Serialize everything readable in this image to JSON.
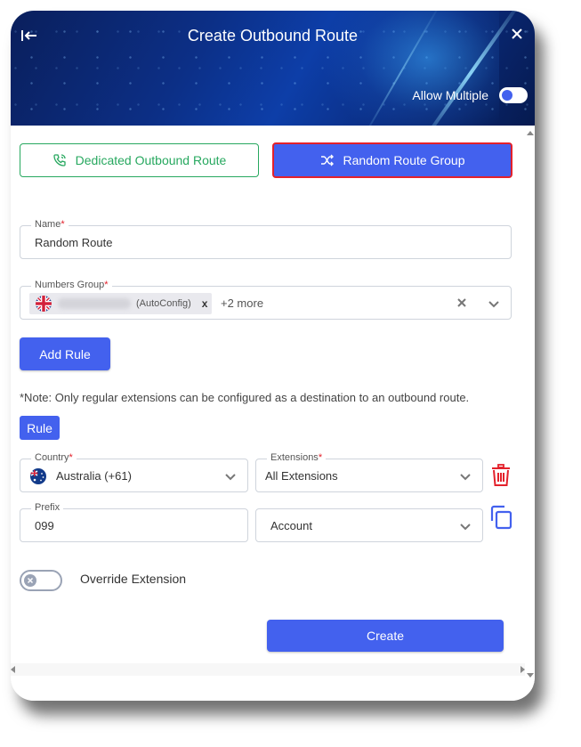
{
  "header": {
    "title": "Create Outbound Route",
    "allow_multiple_label": "Allow Multiple",
    "allow_multiple_on": true,
    "back_icon": "arrow-left-bar-icon",
    "close_icon": "close-icon"
  },
  "tabs": {
    "dedicated_label": "Dedicated Outbound Route",
    "random_label": "Random Route Group",
    "active": "random"
  },
  "name_field": {
    "label": "Name",
    "required_mark": "*",
    "value": "Random Route"
  },
  "numbers_group": {
    "label": "Numbers Group",
    "required_mark": "*",
    "chip_suffix": "(AutoConfig)",
    "chip_remove": "x",
    "more_text": "+2 more"
  },
  "add_rule_label": "Add Rule",
  "note_text": "*Note: Only regular extensions can be configured as a destination to an outbound route.",
  "rule_badge": "Rule",
  "country_field": {
    "label": "Country",
    "required_mark": "*",
    "value": "Australia (+61)"
  },
  "extensions_field": {
    "label": "Extensions",
    "required_mark": "*",
    "value": "All Extensions"
  },
  "prefix_field": {
    "label": "Prefix",
    "value": "099"
  },
  "account_field": {
    "value": "Account"
  },
  "override_label": "Override Extension",
  "override_on": false,
  "create_label": "Create",
  "colors": {
    "primary": "#4361ee",
    "green": "#27a85f",
    "danger": "#e3212b"
  }
}
